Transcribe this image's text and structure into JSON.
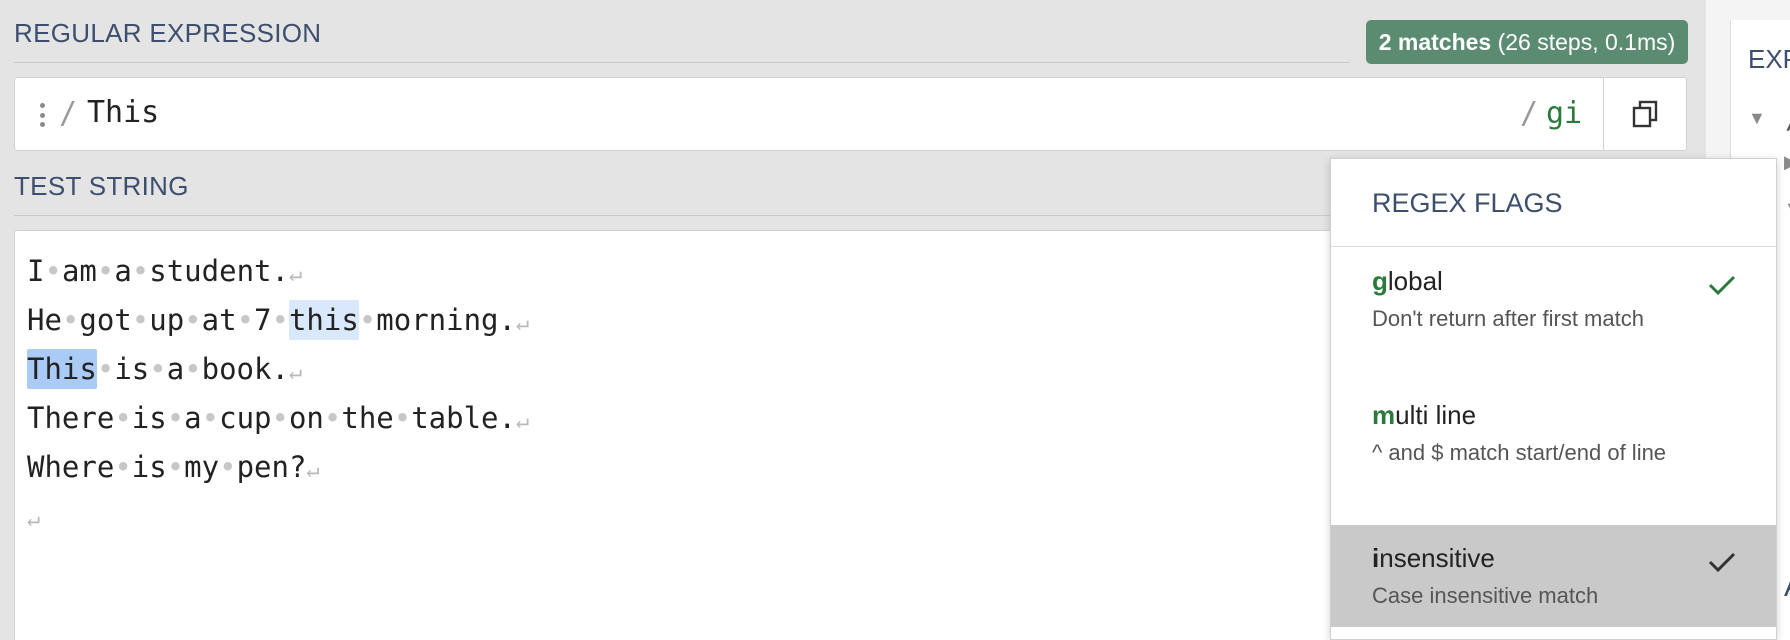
{
  "regex_section": {
    "title": "REGULAR EXPRESSION",
    "match_count": "2 matches",
    "match_detail": "(26 steps, 0.1ms)",
    "delimiter_open": "/",
    "pattern": "This",
    "delimiter_close": "/",
    "flags": "gi"
  },
  "test_section": {
    "title": "TEST STRING",
    "lines": [
      {
        "segments": [
          {
            "t": "I",
            "type": "text"
          },
          {
            "t": "•",
            "type": "ws"
          },
          {
            "t": "am",
            "type": "text"
          },
          {
            "t": "•",
            "type": "ws"
          },
          {
            "t": "a",
            "type": "text"
          },
          {
            "t": "•",
            "type": "ws"
          },
          {
            "t": "student.",
            "type": "text"
          },
          {
            "t": "↵",
            "type": "nl"
          }
        ]
      },
      {
        "segments": [
          {
            "t": "He",
            "type": "text"
          },
          {
            "t": "•",
            "type": "ws"
          },
          {
            "t": "got",
            "type": "text"
          },
          {
            "t": "•",
            "type": "ws"
          },
          {
            "t": "up",
            "type": "text"
          },
          {
            "t": "•",
            "type": "ws"
          },
          {
            "t": "at",
            "type": "text"
          },
          {
            "t": "•",
            "type": "ws"
          },
          {
            "t": "7",
            "type": "text"
          },
          {
            "t": "•",
            "type": "ws"
          },
          {
            "t": "this",
            "type": "match1"
          },
          {
            "t": "•",
            "type": "ws"
          },
          {
            "t": "morning.",
            "type": "text"
          },
          {
            "t": "↵",
            "type": "nl"
          }
        ]
      },
      {
        "segments": [
          {
            "t": "This",
            "type": "match2"
          },
          {
            "t": "•",
            "type": "ws"
          },
          {
            "t": "is",
            "type": "text"
          },
          {
            "t": "•",
            "type": "ws"
          },
          {
            "t": "a",
            "type": "text"
          },
          {
            "t": "•",
            "type": "ws"
          },
          {
            "t": "book.",
            "type": "text"
          },
          {
            "t": "↵",
            "type": "nl"
          }
        ]
      },
      {
        "segments": [
          {
            "t": "There",
            "type": "text"
          },
          {
            "t": "•",
            "type": "ws"
          },
          {
            "t": "is",
            "type": "text"
          },
          {
            "t": "•",
            "type": "ws"
          },
          {
            "t": "a",
            "type": "text"
          },
          {
            "t": "•",
            "type": "ws"
          },
          {
            "t": "cup",
            "type": "text"
          },
          {
            "t": "•",
            "type": "ws"
          },
          {
            "t": "on",
            "type": "text"
          },
          {
            "t": "•",
            "type": "ws"
          },
          {
            "t": "the",
            "type": "text"
          },
          {
            "t": "•",
            "type": "ws"
          },
          {
            "t": "table.",
            "type": "text"
          },
          {
            "t": "↵",
            "type": "nl"
          }
        ]
      },
      {
        "segments": [
          {
            "t": "Where",
            "type": "text"
          },
          {
            "t": "•",
            "type": "ws"
          },
          {
            "t": "is",
            "type": "text"
          },
          {
            "t": "•",
            "type": "ws"
          },
          {
            "t": "my",
            "type": "text"
          },
          {
            "t": "•",
            "type": "ws"
          },
          {
            "t": "pen?",
            "type": "text"
          },
          {
            "t": "↵",
            "type": "nl"
          }
        ]
      },
      {
        "segments": [
          {
            "t": "↵",
            "type": "nl"
          }
        ]
      }
    ]
  },
  "flags_menu": {
    "title": "REGEX FLAGS",
    "items": [
      {
        "key": "g",
        "rest": "lobal",
        "desc": "Don't return after first match",
        "checked": true
      },
      {
        "key": "m",
        "rest": "ulti line",
        "desc": "^ and $ match start/end of line",
        "checked": false
      },
      {
        "key": "i",
        "rest": "nsensitive",
        "desc": "Case insensitive match",
        "checked": true
      }
    ]
  },
  "right_panel": {
    "title": "EXP",
    "slash": "/",
    "letter": "A"
  },
  "icons": {
    "drag": "drag-handle-icon",
    "copy": "copy-icon",
    "check": "checkmark-icon",
    "arrow": "caret-icon"
  },
  "colors": {
    "accent_title": "#3d4f6e",
    "match_badge": "#5b8c72",
    "flag_key": "#2b7a3b",
    "match_highlight": "#d9e8fb",
    "match_highlight_active": "#a9cbf5",
    "menu_active_bg": "#c9c9c9"
  }
}
